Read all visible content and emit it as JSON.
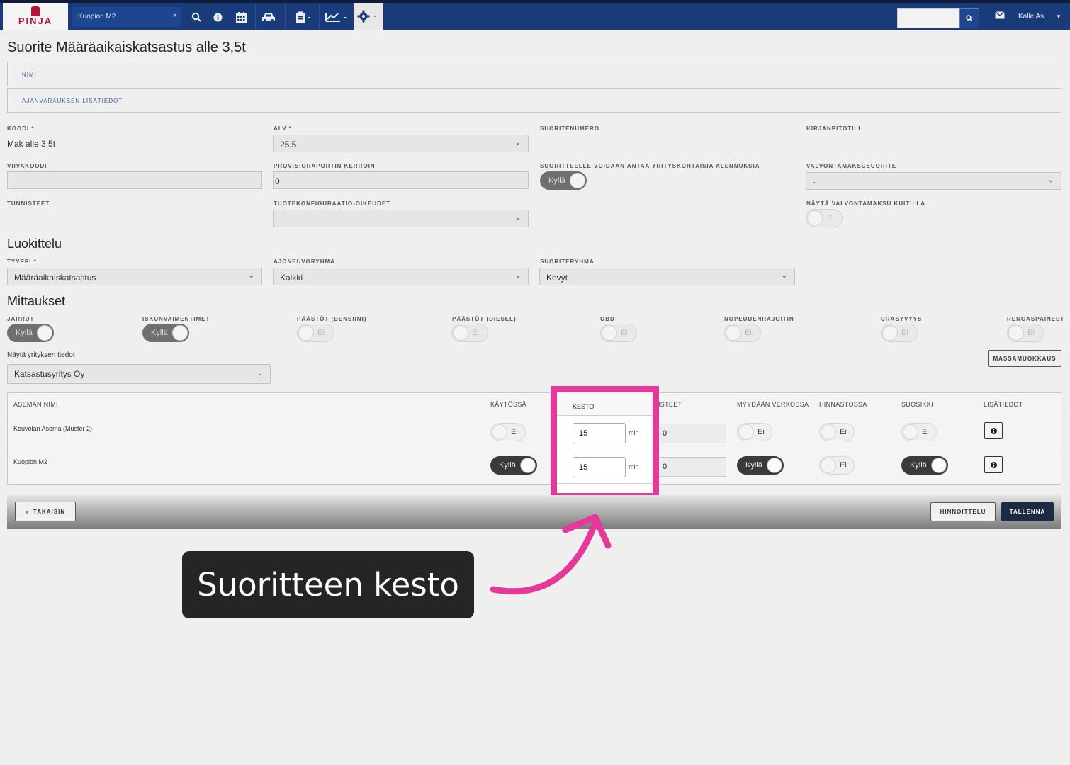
{
  "topbar": {
    "logo_text": "PINJA",
    "location": "Kuopion M2",
    "user": "Kalle As...",
    "icons": [
      "search-icon",
      "info-icon",
      "calendar-icon",
      "car-icon",
      "clipboard-icon",
      "chart-icon",
      "gear-icon",
      "mail-icon"
    ]
  },
  "page": {
    "title": "Suorite Määräaikaiskatsastus alle 3,5t",
    "sections": {
      "nimi": "NIMI",
      "ajanvaraus": "AJANVARAUKSEN LISÄTIEDOT"
    }
  },
  "form": {
    "koodi_label": "KOODI",
    "koodi_value": "Mak alle 3,5t",
    "alv_label": "ALV",
    "alv_value": "25,5",
    "suoritenumero_label": "SUORITENUMERO",
    "kirjanpitotili_label": "KIRJANPITOTILI",
    "viivakoodi_label": "VIIVAKOODI",
    "provisio_label": "PROVISIORAPORTIN KERROIN",
    "provisio_value": "0",
    "alennus_label": "SUORITTEELLE VOIDAAN ANTAA YRITYSKOHTAISIA ALENNUKSIA",
    "alennus_value": "Kyllä",
    "valvonta_label": "VALVONTAMAKSUSUORITE",
    "valvonta_value": "-",
    "tunnisteet_label": "TUNNISTEET",
    "tuotekonf_label": "TUOTEKONFIGURAATIO-OIKEUDET",
    "nayta_valvonta_label": "NÄYTÄ VALVONTAMAKSU KUITILLA",
    "nayta_valvonta_value": "Ei"
  },
  "luokittelu": {
    "heading": "Luokittelu",
    "tyyppi_label": "TYYPPI",
    "tyyppi_value": "Määräaikaiskatsastus",
    "ajoneuvo_label": "AJONEUVORYHMÄ",
    "ajoneuvo_value": "Kaikki",
    "suoriteryhma_label": "SUORITERYHMÄ",
    "suoriteryhma_value": "Kevyt"
  },
  "mittaukset": {
    "heading": "Mittaukset",
    "items": [
      {
        "label": "JARRUT",
        "value": "Kyllä"
      },
      {
        "label": "ISKUNVAIMENTIMET",
        "value": "Kyllä"
      },
      {
        "label": "PÄÄSTÖT (BENSIINI)",
        "value": "Ei"
      },
      {
        "label": "PÄÄSTÖT (DIESEL)",
        "value": "Ei"
      },
      {
        "label": "OBD",
        "value": "Ei"
      },
      {
        "label": "NOPEUDENRAJOITIN",
        "value": "Ei"
      },
      {
        "label": "URASYVYYS",
        "value": "Ei"
      },
      {
        "label": "RENGASPAINEET",
        "value": "Ei"
      }
    ],
    "yritys_label": "Näytä yrityksen tiedot",
    "yritys_value": "Katsastusyritys Oy",
    "massamuokkaus": "MASSAMUOKKAUS"
  },
  "table": {
    "headers": {
      "asema": "ASEMAN NIMI",
      "kaytossa": "KÄYTÖSSÄ",
      "kesto": "KESTO",
      "tunnisteet": "ISTEET",
      "myydaan": "MYYDÄÄN VERKOSSA",
      "hinnastossa": "HINNASTOSSA",
      "suosikki": "SUOSIKKI",
      "lisatiedot": "LISÄTIEDOT"
    },
    "rows": [
      {
        "name": "Kouvolan Asema (Muster 2)",
        "kaytossa": "Ei",
        "kesto": "15",
        "unit": "min",
        "tunniste": "0",
        "myydaan": "Ei",
        "hinnastossa": "Ei",
        "suosikki": "Ei"
      },
      {
        "name": "Kuopion M2",
        "kaytossa": "Kyllä",
        "kesto": "15",
        "unit": "min",
        "tunniste": "0",
        "myydaan": "Kyllä",
        "hinnastossa": "Ei",
        "suosikki": "Kyllä"
      }
    ]
  },
  "footer": {
    "back": "TAKAISIN",
    "pricing": "HINNOITTELU",
    "save": "TALLENNA"
  },
  "callout": {
    "text": "Suoritteen kesto"
  },
  "colors": {
    "topbar": "#1a3b7a",
    "highlight": "#e5399a",
    "callout_bg": "#252525"
  }
}
